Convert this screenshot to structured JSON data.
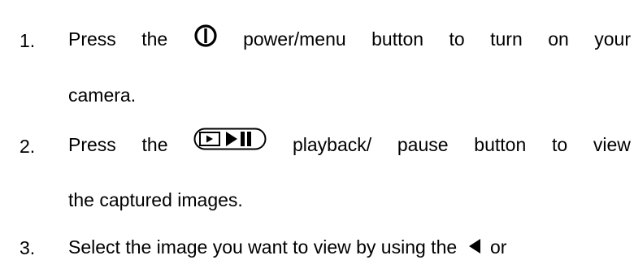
{
  "steps": [
    {
      "number": "1.",
      "line1": {
        "w1": "Press",
        "w2": "the",
        "icon": "power-menu-icon",
        "w3": "power/menu",
        "w4": "button",
        "w5": "to",
        "w6": "turn",
        "w7": "on",
        "w8": "your"
      },
      "line2": "camera."
    },
    {
      "number": "2.",
      "line1": {
        "w1": "Press",
        "w2": "the",
        "icon": "playback-pause-icon",
        "w3": "playback/",
        "w4": "pause",
        "w5": "button",
        "w6": "to",
        "w7": "view"
      },
      "line2": "the captured images."
    },
    {
      "number": "3.",
      "line1": {
        "text": "Select the image you want to view by using the",
        "icon": "left-arrow-icon",
        "tail": "or"
      }
    }
  ]
}
